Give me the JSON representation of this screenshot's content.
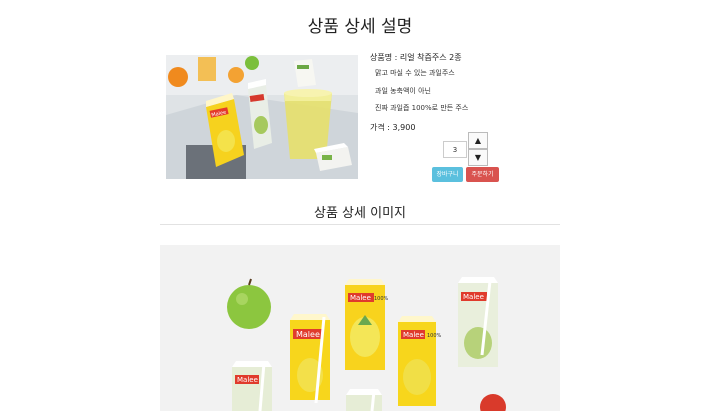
{
  "page": {
    "title": "상품 상세 설명"
  },
  "product": {
    "name_line": "상품명 : 리얼 착즙주스 2종",
    "descriptions": [
      "맑고 마실 수 있는 과일주스",
      "과일 농축액이 아닌",
      "진짜 과일즙 100%로 만든 주스"
    ],
    "price_line": "가격 : 3,900",
    "photo_brand": "Malee"
  },
  "order": {
    "quantity": "3",
    "increment_label": "▲",
    "decrement_label": "▼",
    "cart_label": "장바구니",
    "order_label": "주문하기",
    "cart_color": "#5bc0de",
    "order_color": "#d9534f"
  },
  "detail": {
    "section_title": "상품 상세 이미지",
    "photo_brand": "Malee",
    "carton_text": "100%"
  }
}
